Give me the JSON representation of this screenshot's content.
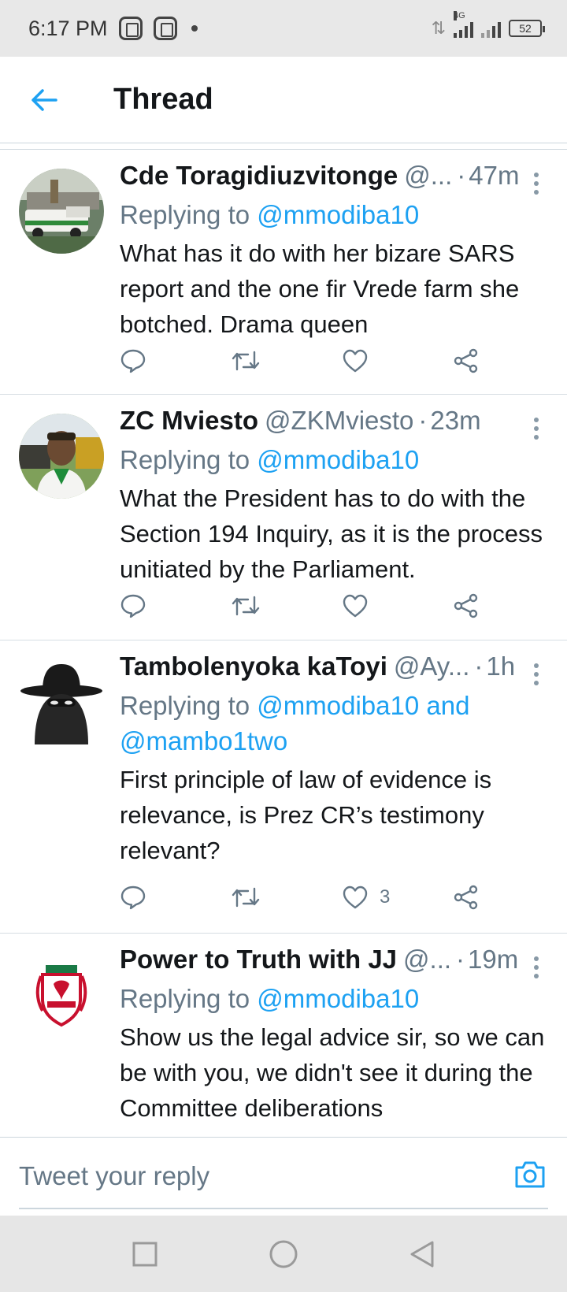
{
  "status_bar": {
    "time": "6:17 PM",
    "network": "4G",
    "battery": "52"
  },
  "header": {
    "title": "Thread"
  },
  "tweets": [
    {
      "name": "Cde Toragidiuzvitonge",
      "handle": "@...",
      "separator": "·",
      "time": "47m",
      "reply_prefix": "Replying to ",
      "reply_mentions": "@mmodiba10",
      "text": "What has it do with her bizare SARS report and the one fir Vrede farm she botched. Drama queen",
      "like_count": ""
    },
    {
      "name": "ZC Mviesto",
      "handle": "@ZKMviesto",
      "separator": "·",
      "time": "23m",
      "reply_prefix": "Replying to ",
      "reply_mentions": "@mmodiba10",
      "text": "What the President has to do with the Section 194 Inquiry, as it is the process unitiated by the Parliament.",
      "like_count": ""
    },
    {
      "name": "Tambolenyoka kaToyi",
      "handle": "@Ay...",
      "separator": "·",
      "time": "1h",
      "reply_prefix": "Replying to ",
      "reply_mentions": "@mmodiba10 and @mambo1two",
      "text": "First principle of law of evidence is relevance, is Prez CR’s testimony relevant?",
      "like_count": "3"
    },
    {
      "name": "Power to Truth with JJ",
      "handle": "@...",
      "separator": "·",
      "time": "19m",
      "reply_prefix": "Replying to ",
      "reply_mentions": "@mmodiba10",
      "text": "Show us the legal advice sir, so we can be with you, we didn't see it during the Committee deliberations",
      "like_count": ""
    }
  ],
  "reply_bar": {
    "placeholder": "Tweet your reply"
  },
  "icons": {
    "back": "arrow-left-icon",
    "more": "more-vertical-icon",
    "reply": "comment-icon",
    "retweet": "retweet-icon",
    "like": "heart-icon",
    "share": "share-icon",
    "camera": "camera-icon"
  },
  "colors": {
    "accent": "#1da1f2",
    "muted": "#657786",
    "text": "#14171a"
  }
}
